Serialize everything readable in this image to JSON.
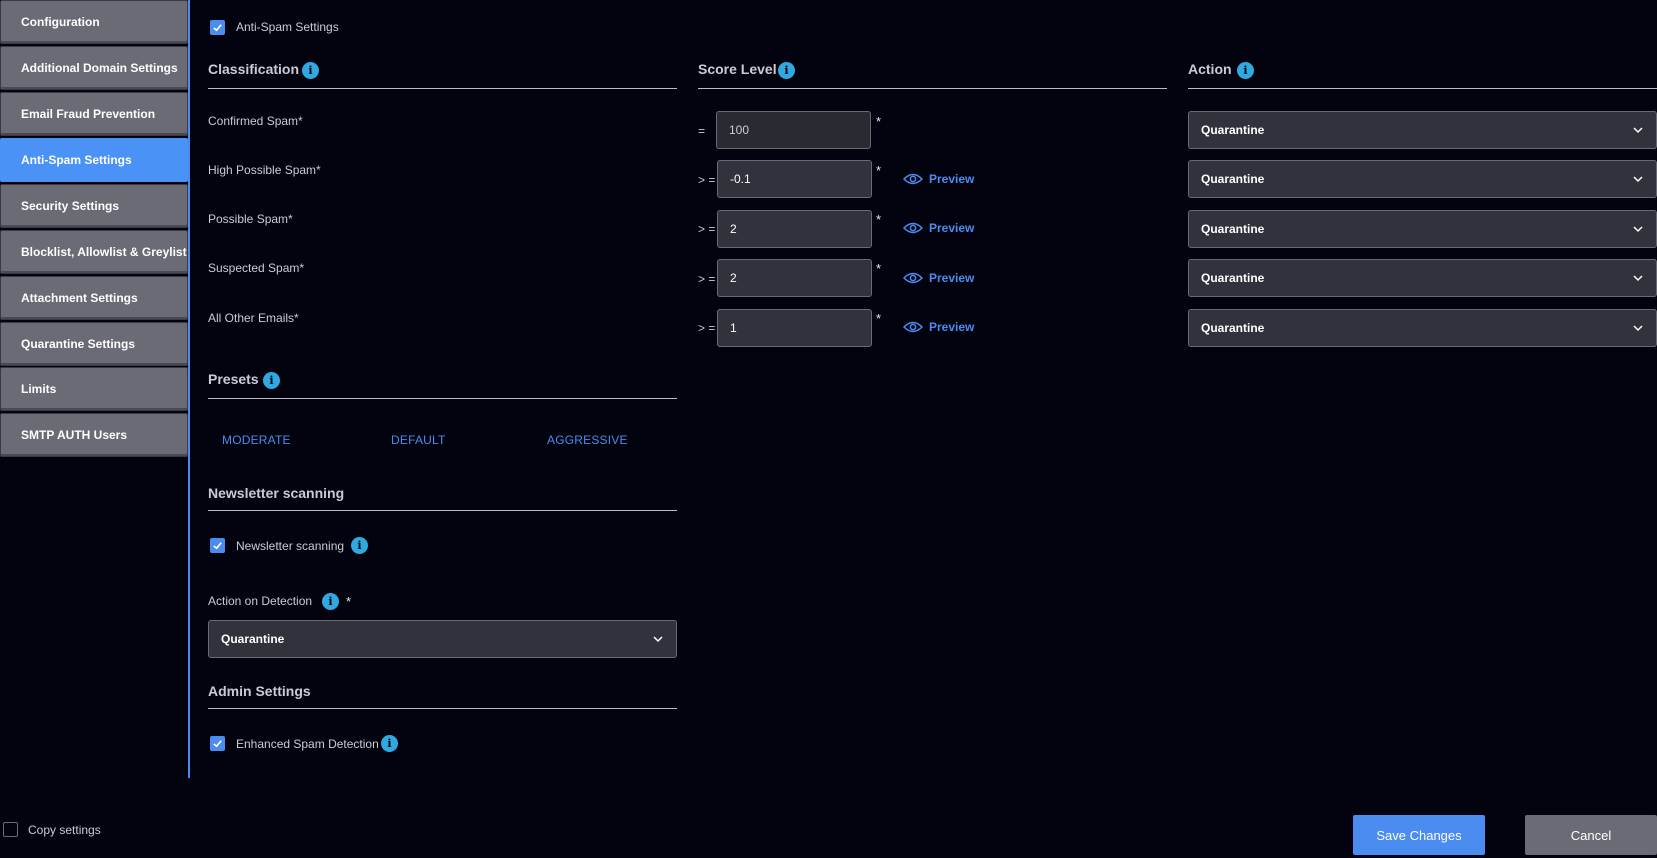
{
  "sidebar": {
    "items": [
      {
        "label": "Configuration"
      },
      {
        "label": "Additional Domain Settings"
      },
      {
        "label": "Email Fraud Prevention"
      },
      {
        "label": "Anti-Spam Settings"
      },
      {
        "label": "Security Settings"
      },
      {
        "label": "Blocklist, Allowlist & Greylist"
      },
      {
        "label": "Attachment Settings"
      },
      {
        "label": "Quarantine Settings"
      },
      {
        "label": "Limits"
      },
      {
        "label": "SMTP AUTH Users"
      }
    ],
    "active_index": 3
  },
  "antispam_toggle": {
    "label": "Anti-Spam Settings",
    "checked": true
  },
  "columns": {
    "classification": "Classification",
    "score_level": "Score Level",
    "action": "Action"
  },
  "rows": [
    {
      "name": "Confirmed Spam*",
      "operator": "=",
      "score": "100",
      "required": "*",
      "preview": "",
      "action": "Quarantine"
    },
    {
      "name": "High Possible Spam*",
      "operator": "> =",
      "score": "-0.1",
      "required": "*",
      "preview": "Preview",
      "action": "Quarantine"
    },
    {
      "name": "Possible Spam*",
      "operator": "> =",
      "score": "2",
      "required": "*",
      "preview": "Preview",
      "action": "Quarantine"
    },
    {
      "name": "Suspected Spam*",
      "operator": "> =",
      "score": "2",
      "required": "*",
      "preview": "Preview",
      "action": "Quarantine"
    },
    {
      "name": "All Other Emails*",
      "operator": "> =",
      "score": "1",
      "required": "*",
      "preview": "Preview",
      "action": "Quarantine"
    }
  ],
  "presets": {
    "title": "Presets",
    "options": [
      "MODERATE",
      "DEFAULT",
      "AGGRESSIVE"
    ]
  },
  "newsletter": {
    "title": "Newsletter scanning",
    "checkbox_label": "Newsletter scanning",
    "checked": true,
    "action_label": "Action on Detection",
    "action_required": "*",
    "action_value": "Quarantine"
  },
  "admin": {
    "title": "Admin Settings",
    "checkbox_label": "Enhanced Spam Detection",
    "checked": true
  },
  "footer": {
    "copy_settings": "Copy settings",
    "copy_checked": false,
    "save": "Save Changes",
    "cancel": "Cancel"
  },
  "colors": {
    "background": "#03030f",
    "accent": "#4a8cf0",
    "info": "#2fa9e0",
    "sidebar_item": "#6b6b76",
    "cancel_button": "#6b6b76"
  },
  "icons": {
    "info": "info-icon",
    "check": "check-icon",
    "preview": "eye-icon",
    "dropdown": "chevron-down-icon"
  }
}
